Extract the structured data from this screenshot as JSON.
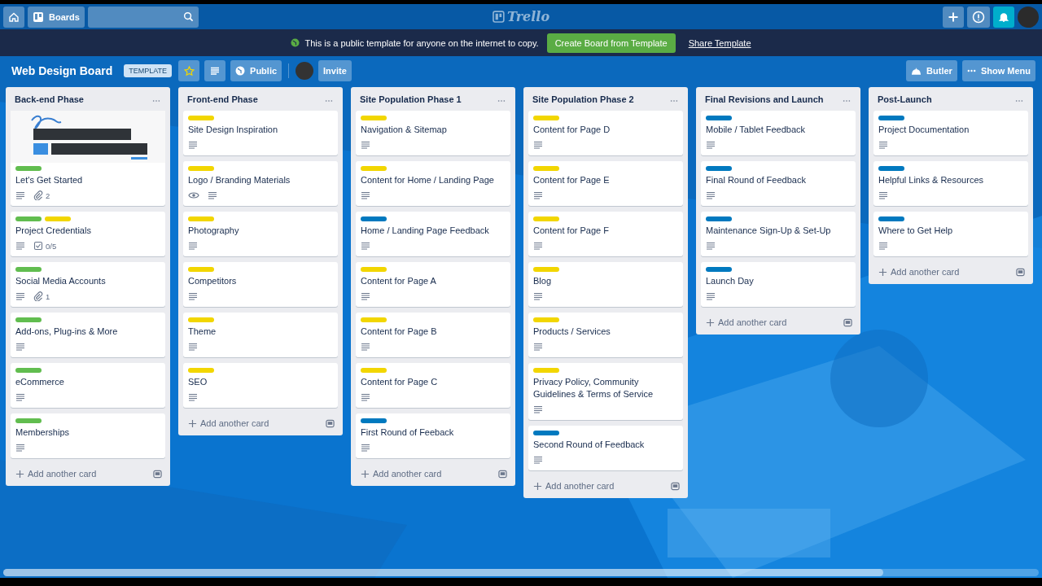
{
  "header": {
    "boards_button": "Boards",
    "logo": "Trello"
  },
  "banner": {
    "message": "This is a public template for anyone on the internet to copy.",
    "create_button": "Create Board from Template",
    "share_link": "Share Template"
  },
  "board": {
    "title": "Web Design Board",
    "template_badge": "TEMPLATE",
    "starred": true,
    "visibility": "Public",
    "invite": "Invite",
    "butler": "Butler",
    "show_menu": "Show Menu"
  },
  "lists": [
    {
      "title": "Back-end Phase",
      "add_card": "Add another card",
      "cards": [
        {
          "cover": {
            "kind": "picture"
          },
          "labels": [
            {
              "color": "#61bd4f"
            }
          ],
          "title": "Let's Get Started",
          "badges": [
            {
              "kind": "description"
            },
            {
              "kind": "attachment",
              "text": "2"
            }
          ]
        },
        {
          "labels": [
            {
              "color": "#61bd4f"
            },
            {
              "color": "#f2d600"
            }
          ],
          "title": "Project Credentials",
          "badges": [
            {
              "kind": "description"
            },
            {
              "kind": "checklist",
              "text": "0/5"
            }
          ]
        },
        {
          "labels": [
            {
              "color": "#61bd4f"
            }
          ],
          "title": "Social Media Accounts",
          "badges": [
            {
              "kind": "description"
            },
            {
              "kind": "attachment",
              "text": "1"
            }
          ]
        },
        {
          "labels": [
            {
              "color": "#61bd4f"
            }
          ],
          "title": "Add-ons, Plug-ins & More",
          "badges": [
            {
              "kind": "description"
            }
          ]
        },
        {
          "labels": [
            {
              "color": "#61bd4f"
            }
          ],
          "title": "eCommerce",
          "badges": [
            {
              "kind": "description"
            }
          ]
        },
        {
          "labels": [
            {
              "color": "#61bd4f"
            }
          ],
          "title": "Memberships",
          "badges": [
            {
              "kind": "description"
            }
          ]
        }
      ]
    },
    {
      "title": "Front-end Phase",
      "add_card": "Add another card",
      "cards": [
        {
          "labels": [
            {
              "color": "#f2d600"
            }
          ],
          "title": "Site Design Inspiration",
          "badges": [
            {
              "kind": "description"
            }
          ]
        },
        {
          "labels": [
            {
              "color": "#f2d600"
            }
          ],
          "title": "Logo / Branding Materials",
          "badges": [
            {
              "kind": "watch"
            },
            {
              "kind": "description"
            }
          ]
        },
        {
          "labels": [
            {
              "color": "#f2d600"
            }
          ],
          "title": "Photography",
          "badges": [
            {
              "kind": "description"
            }
          ]
        },
        {
          "labels": [
            {
              "color": "#f2d600"
            }
          ],
          "title": "Competitors",
          "badges": [
            {
              "kind": "description"
            }
          ]
        },
        {
          "labels": [
            {
              "color": "#f2d600"
            }
          ],
          "title": "Theme",
          "badges": [
            {
              "kind": "description"
            }
          ]
        },
        {
          "labels": [
            {
              "color": "#f2d600"
            }
          ],
          "title": "SEO",
          "badges": [
            {
              "kind": "description"
            }
          ]
        }
      ]
    },
    {
      "title": "Site Population Phase 1",
      "add_card": "Add another card",
      "cards": [
        {
          "labels": [
            {
              "color": "#f2d600"
            }
          ],
          "title": "Navigation & Sitemap",
          "badges": [
            {
              "kind": "description"
            }
          ]
        },
        {
          "labels": [
            {
              "color": "#f2d600"
            }
          ],
          "title": "Content for Home / Landing Page",
          "badges": [
            {
              "kind": "description"
            }
          ]
        },
        {
          "labels": [
            {
              "color": "#0079bf"
            }
          ],
          "title": "Home / Landing Page Feedback",
          "badges": [
            {
              "kind": "description"
            }
          ]
        },
        {
          "labels": [
            {
              "color": "#f2d600"
            }
          ],
          "title": "Content for Page A",
          "badges": [
            {
              "kind": "description"
            }
          ]
        },
        {
          "labels": [
            {
              "color": "#f2d600"
            }
          ],
          "title": "Content for Page B",
          "badges": [
            {
              "kind": "description"
            }
          ]
        },
        {
          "labels": [
            {
              "color": "#f2d600"
            }
          ],
          "title": "Content for Page C",
          "badges": [
            {
              "kind": "description"
            }
          ]
        },
        {
          "labels": [
            {
              "color": "#0079bf"
            }
          ],
          "title": "First Round of Feeback",
          "badges": [
            {
              "kind": "description"
            }
          ]
        }
      ]
    },
    {
      "title": "Site Population Phase 2",
      "add_card": "Add another card",
      "cards": [
        {
          "labels": [
            {
              "color": "#f2d600"
            }
          ],
          "title": "Content for Page D",
          "badges": [
            {
              "kind": "description"
            }
          ]
        },
        {
          "labels": [
            {
              "color": "#f2d600"
            }
          ],
          "title": "Content for Page E",
          "badges": [
            {
              "kind": "description"
            }
          ]
        },
        {
          "labels": [
            {
              "color": "#f2d600"
            }
          ],
          "title": "Content for Page F",
          "badges": [
            {
              "kind": "description"
            }
          ]
        },
        {
          "labels": [
            {
              "color": "#f2d600"
            }
          ],
          "title": "Blog",
          "badges": [
            {
              "kind": "description"
            }
          ]
        },
        {
          "labels": [
            {
              "color": "#f2d600"
            }
          ],
          "title": "Products / Services",
          "badges": [
            {
              "kind": "description"
            }
          ]
        },
        {
          "labels": [
            {
              "color": "#f2d600"
            }
          ],
          "title": "Privacy Policy, Community Guidelines & Terms of Service",
          "badges": [
            {
              "kind": "description"
            }
          ]
        },
        {
          "labels": [
            {
              "color": "#0079bf"
            }
          ],
          "title": "Second Round of Feedback",
          "badges": [
            {
              "kind": "description"
            }
          ]
        }
      ]
    },
    {
      "title": "Final Revisions and Launch",
      "add_card": "Add another card",
      "cards": [
        {
          "labels": [
            {
              "color": "#0079bf"
            }
          ],
          "title": "Mobile / Tablet Feedback",
          "badges": [
            {
              "kind": "description"
            }
          ]
        },
        {
          "labels": [
            {
              "color": "#0079bf"
            }
          ],
          "title": "Final Round of Feedback",
          "badges": [
            {
              "kind": "description"
            }
          ]
        },
        {
          "labels": [
            {
              "color": "#0079bf"
            }
          ],
          "title": "Maintenance Sign-Up & Set-Up",
          "badges": [
            {
              "kind": "description"
            }
          ]
        },
        {
          "labels": [
            {
              "color": "#0079bf"
            }
          ],
          "title": "Launch Day",
          "badges": [
            {
              "kind": "description"
            }
          ]
        }
      ]
    },
    {
      "title": "Post-Launch",
      "add_card": "Add another card",
      "cards": [
        {
          "labels": [
            {
              "color": "#0079bf"
            }
          ],
          "title": "Project Documentation",
          "badges": [
            {
              "kind": "description"
            }
          ]
        },
        {
          "labels": [
            {
              "color": "#0079bf"
            }
          ],
          "title": "Helpful Links & Resources",
          "badges": [
            {
              "kind": "description"
            }
          ]
        },
        {
          "labels": [
            {
              "color": "#0079bf"
            }
          ],
          "title": "Where to Get Help",
          "badges": [
            {
              "kind": "description"
            }
          ]
        }
      ]
    }
  ]
}
